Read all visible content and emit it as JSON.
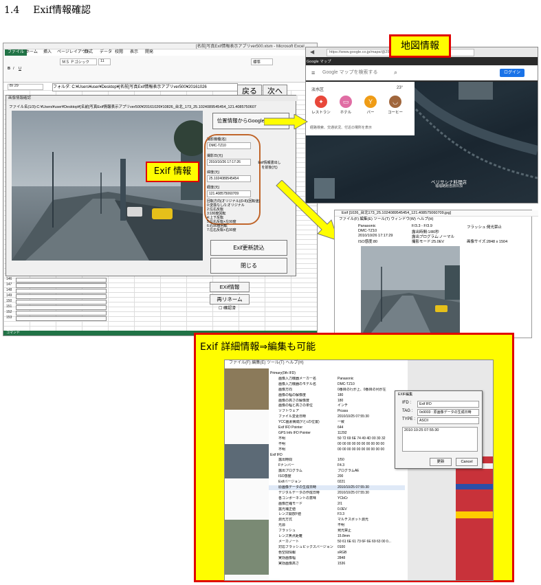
{
  "heading": {
    "number": "1.4",
    "title": "Exif情報確認"
  },
  "labels": {
    "map": "地図情報",
    "exif": "Exif 情報",
    "detail": "Exif 詳細情報⇒編集も可能"
  },
  "excel": {
    "title": "[名前]写真Exif情報表示アプリver500.xlsm - Microsoft Excel",
    "tabs": [
      "ファイル",
      "ホーム",
      "挿入",
      "ページレイアウト",
      "数式",
      "データ",
      "校閲",
      "表示",
      "開発"
    ],
    "font_name": "ＭＳ Ｐゴシック",
    "font_size": "11",
    "style_value": "標準",
    "cell_ref": "BI 29",
    "folder_label": "フォルダ:",
    "folder_value": "C:¥Users¥user¥Desktop¥[名前]写真Exif情報表示アプリver500¥20161026",
    "back": "戻る",
    "next": "次へ",
    "row_labels": [
      "146",
      "147",
      "148",
      "149",
      "150",
      "151",
      "152",
      "153"
    ],
    "status": "コマンド"
  },
  "dialog": {
    "title": "画像情報確認",
    "path": "ファイル名(1/3):C:¥Users¥user¥Desktop¥[名前]写真Exif情報表示アプリver500¥20161026¥10826_台北_173_25.1024089545454_121.408575060709.jpg",
    "gmap_button": "位置情報からGoogleMap開く",
    "fields": [
      {
        "label": "撮影機種(名)",
        "value": "DMC-TZ10"
      },
      {
        "label": "撮影日(元)",
        "value": "2010/10/26 17:17:26"
      },
      {
        "label": "緯度(元)",
        "value": "25.1024089545454"
      },
      {
        "label": "経度(元)",
        "value": "121.408575060709"
      }
    ],
    "side_note": "Exif情報書出しを前後(元)",
    "orientation": [
      "回転方向(オリジナル)(0-8)(回転値)",
      "0:変換なし/1:オリジナル",
      "2:左右反転",
      "3:180度回転",
      "4:上下反転",
      "5:左右反転+左90度",
      "6:右90度回転",
      "7:左右反転+右90度",
      "8:左90度回転"
    ],
    "reload": "Exif更新読込",
    "close": "閉じる"
  },
  "lower_buttons": {
    "exif": "EXif情報",
    "rename": "再リネーム",
    "confirm": "確認済"
  },
  "chrome": {
    "url": "https://www.google.co.jp/maps/@25.1",
    "tab": "Google マップ",
    "search_placeholder": "Google マップを検索する",
    "login": "ログイン",
    "area": "淡水区",
    "temp": "23°",
    "pois": [
      "レストラン",
      "ホテル",
      "バー",
      "コーヒー"
    ],
    "hint": "経路検索、交通状況、付近の場所を表示",
    "caption1": "ベリサシナ料理店",
    "caption2": "福福路館咨詢日加"
  },
  "viewer": {
    "title": "Exif [1026_台北173_25.1024089545454_121.408575060709.jpg]",
    "menu": "ファイル(F)  編集(E)  ツール(T)  ウィンドウ(W)  ヘルプ(H)",
    "fields": [
      "Panasonic",
      "DMC-TZ10",
      "2010/10/26 17:17:29",
      "ISO感度:80",
      "F/3.3 - F/3.9",
      "露出時間:1/80秒",
      "露出プログラム:ノーマル",
      "撮影日:1(撮影)",
      "撮影モード:25.0EV",
      "フラッシュ:発光禁止",
      "画像サイズ:2848 x 1504"
    ]
  },
  "detail": {
    "menu": "ファイル(F)  編集(E)  ツール(T)  ヘルプ(H)",
    "rows": [
      {
        "k": "Primary(0th IFD)",
        "v": "",
        "hdr": true
      },
      {
        "k": "画像入力機器メーカー名",
        "v": "Panasonic"
      },
      {
        "k": "画像入力機器のモデル名",
        "v": "DMC-TZ10"
      },
      {
        "k": "画像方向",
        "v": "0番目の行が上、0番目の列が左"
      },
      {
        "k": "画像の幅の解像度",
        "v": "180"
      },
      {
        "k": "画像の高さの解像度",
        "v": "180"
      },
      {
        "k": "画像の幅と高さの単位",
        "v": "インチ"
      },
      {
        "k": "ソフトウェア",
        "v": "Picasa"
      },
      {
        "k": "ファイル変更日時",
        "v": "2010/10/25 07:55:30"
      },
      {
        "k": "YCC画素構成(Yとcの位置)",
        "v": "一致"
      },
      {
        "k": "Exif IFD Pointer",
        "v": "644"
      },
      {
        "k": "GPS Info IFD Pointer",
        "v": "11292"
      },
      {
        "k": "不明",
        "v": "50 72 69 6E 74 49 4D 00 30 32"
      },
      {
        "k": "不明",
        "v": "00 00 00 00 00 00 00 00 00 00"
      },
      {
        "k": "不明",
        "v": "00 00 00 00 00 00 00 00 00 00"
      },
      {
        "k": "Exif IFD",
        "v": "",
        "hdr": true
      },
      {
        "k": "露出時間",
        "v": "1/50"
      },
      {
        "k": "Fナンバー",
        "v": "F4.3"
      },
      {
        "k": "露出プログラム",
        "v": "プログラムAE"
      },
      {
        "k": "ISO感度",
        "v": "200"
      },
      {
        "k": "Exifバージョン",
        "v": "0221"
      },
      {
        "k": "原画像データの生成日時",
        "v": "2010/10/25 07:55:30",
        "sel": true
      },
      {
        "k": "デジタルデータの作成日時",
        "v": "2010/10/25 07:55:30"
      },
      {
        "k": "各コンポーネントの意味",
        "v": "YCbCr"
      },
      {
        "k": "画像圧縮モード",
        "v": "2/1"
      },
      {
        "k": "露光補正値",
        "v": "0.0EV"
      },
      {
        "k": "レンズ開放F値",
        "v": "F3.3"
      },
      {
        "k": "測光方式",
        "v": "マルチスポット測光"
      },
      {
        "k": "光源",
        "v": "不明"
      },
      {
        "k": "フラッシュ",
        "v": "発光禁止"
      },
      {
        "k": "レンズ焦点距離",
        "v": "15.8mm"
      },
      {
        "k": "メーカノート",
        "v": "50 61 6E 61 73 6F 6E 69 63 00 0..."
      },
      {
        "k": "対応フラッシュピックスバージョン",
        "v": "0100"
      },
      {
        "k": "色空間情報",
        "v": "sRGB"
      },
      {
        "k": "実効画像幅",
        "v": "2848"
      },
      {
        "k": "実効画像高さ",
        "v": "1536"
      }
    ],
    "edit": {
      "title": "EXIF編集",
      "ifd_label": "IFD :",
      "ifd_value": "Exif IFD",
      "tag_label": "TAG :",
      "tag_value": "0x9003 : 原画像データの生成日時",
      "type_label": "TYPE :",
      "type_value": "ASCII",
      "value": "2010:10:25 07:55:30",
      "ok": "更新",
      "cancel": "Cancel"
    }
  }
}
